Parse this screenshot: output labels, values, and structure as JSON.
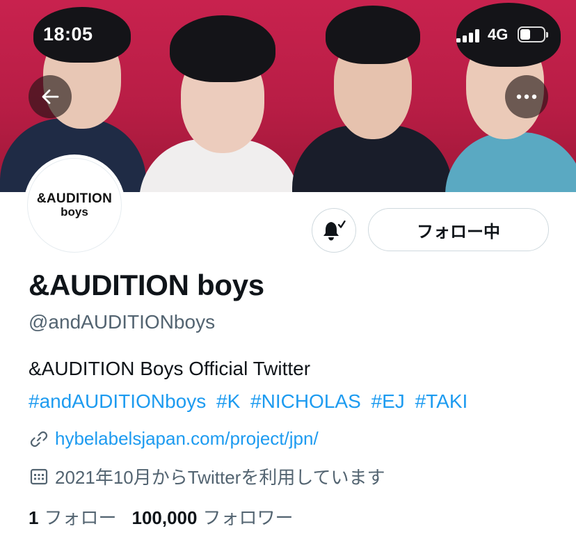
{
  "status_bar": {
    "time": "18:05",
    "network": "4G",
    "signal_bars": 4,
    "battery_level": 0.45
  },
  "header": {
    "back_icon": "arrow-left-icon",
    "more_icon": "more-dots-icon"
  },
  "profile": {
    "avatar_logo_line1": "&AUDITION",
    "avatar_logo_line2": "boys",
    "display_name": "&AUDITION boys",
    "handle": "@andAUDITIONboys",
    "bio": "&AUDITION Boys Official Twitter",
    "hashtags": [
      "#andAUDITIONboys",
      "#K",
      "#NICHOLAS",
      "#EJ",
      "#TAKI"
    ],
    "website": "hybelabelsjapan.com/project/jpn/",
    "joined": "2021年10月からTwitterを利用しています"
  },
  "actions": {
    "notify_icon": "bell-check-icon",
    "follow_label": "フォロー中"
  },
  "stats": {
    "following_count": "1",
    "following_label": "フォロー",
    "followers_count": "100,000",
    "followers_label": "フォロワー"
  },
  "colors": {
    "banner": "#c8224e",
    "link": "#1d9bf0",
    "secondary_text": "#536471",
    "primary_text": "#0f1419",
    "border": "#cfd9de"
  }
}
